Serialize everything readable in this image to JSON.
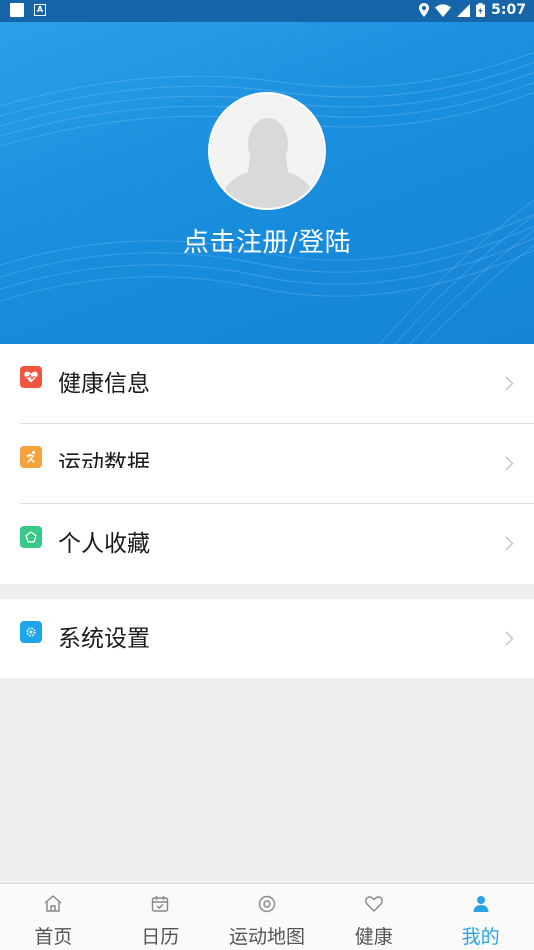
{
  "status_bar": {
    "time": "5:07"
  },
  "profile": {
    "login_text": "点击注册/登陆"
  },
  "menu": [
    {
      "label": "健康信息",
      "icon": "heart-pulse-icon",
      "color": "#f0553f"
    },
    {
      "label": "运动数据",
      "icon": "running-icon",
      "color": "#f5a23c"
    },
    {
      "label": "个人收藏",
      "icon": "pentagon-icon",
      "color": "#37c98a"
    }
  ],
  "settings": {
    "label": "系统设置",
    "icon": "gear-icon",
    "color": "#1fa5ec"
  },
  "tabs": [
    {
      "label": "首页",
      "icon": "home-icon"
    },
    {
      "label": "日历",
      "icon": "calendar-icon"
    },
    {
      "label": "运动地图",
      "icon": "location-icon"
    },
    {
      "label": "健康",
      "icon": "heart-icon"
    },
    {
      "label": "我的",
      "icon": "user-icon",
      "active": true
    }
  ],
  "colors": {
    "header_blue": "#1a8ede",
    "active_tab": "#2aa3e6"
  }
}
